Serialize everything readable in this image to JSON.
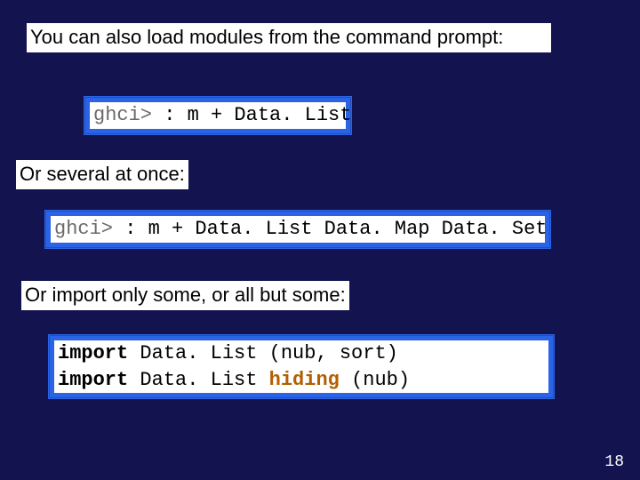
{
  "para1": "You can also load modules from the command prompt:",
  "code1": {
    "prompt": "ghci>",
    "rest": " : m + Data. List"
  },
  "para2": "Or several at once:",
  "code2": {
    "prompt": "ghci>",
    "rest": " : m + Data. List Data. Map Data. Set"
  },
  "para3": "Or import only some, or all but some:",
  "code3": {
    "line1_kw": "import",
    "line1_rest": " Data. List (nub, sort)",
    "line2_kw": "import",
    "line2_mid": " Data. List ",
    "line2_hl": "hiding",
    "line2_end": " (nub)"
  },
  "page_number": "18"
}
